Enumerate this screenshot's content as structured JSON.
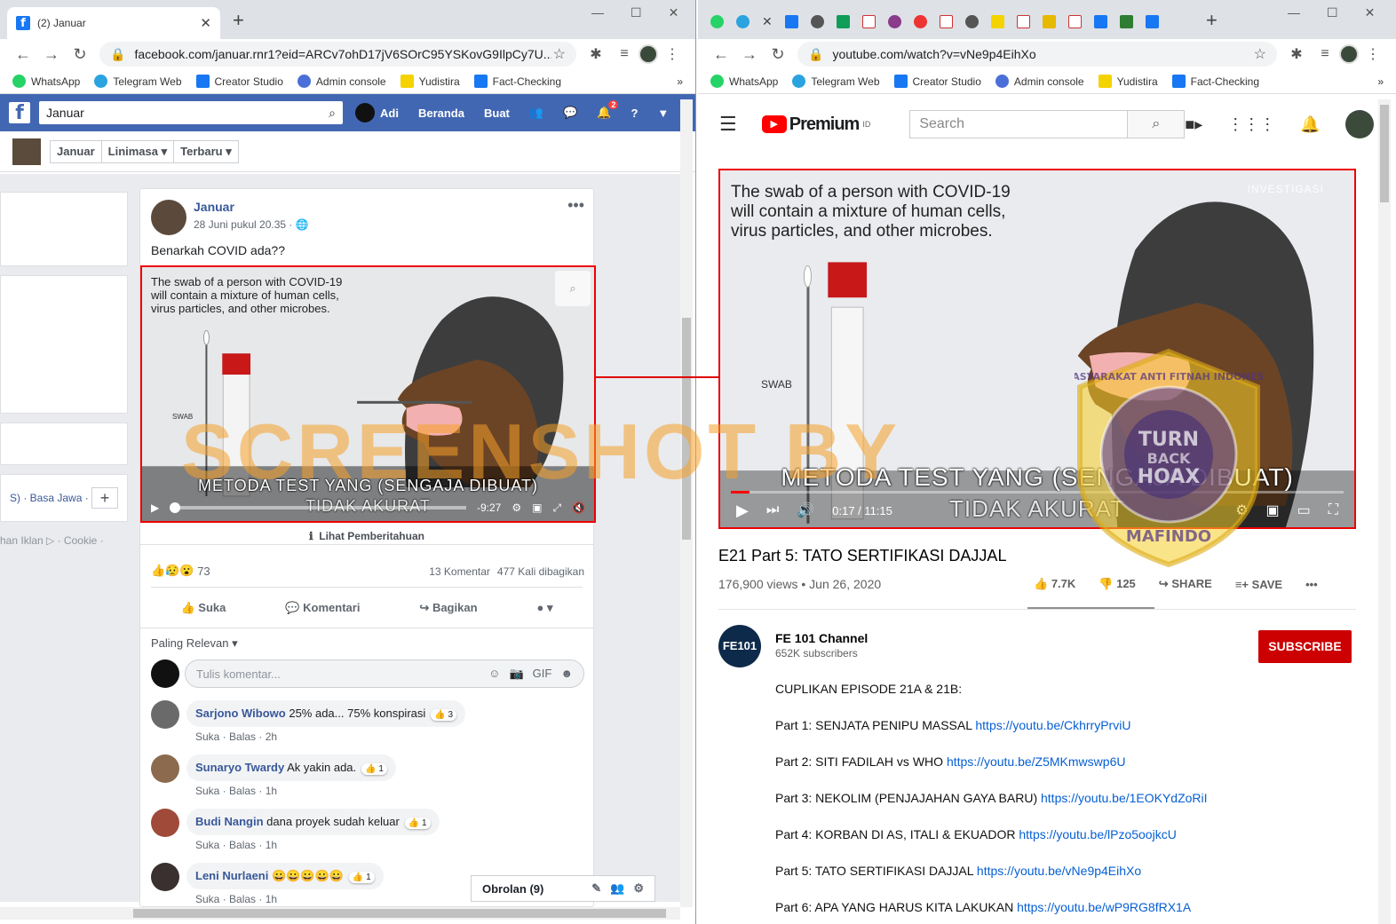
{
  "left": {
    "tab_title": "(2) Januar",
    "url": "facebook.com/januar.rnr1?eid=ARCv7ohD17jV6SOrC95YSKovG9IlpCy7U...",
    "bookmarks": [
      "WhatsApp",
      "Telegram Web",
      "Creator Studio",
      "Admin console",
      "Yudistira",
      "Fact-Checking"
    ],
    "fb": {
      "search_value": "Januar",
      "user": "Adi",
      "nav": [
        "Beranda",
        "Buat"
      ],
      "notif_count": "2",
      "crumbs": [
        "Januar",
        "Linimasa",
        "Terbaru"
      ]
    },
    "side": {
      "lang": "S) · Basa Jawa ·",
      "plus": "+",
      "footer": "han Iklan ▷ · Cookie ·"
    },
    "post": {
      "author": "Januar",
      "date": "28 Juni pukul 20.35 · ",
      "text": "Benarkah COVID ada??",
      "video_caption": "The swab of a person with COVID-19 will contain a mixture of human cells, virus particles, and other microbes.",
      "video_label": "SWAB",
      "subtitle1": "METODA TEST YANG (SENGAJA DIBUAT)",
      "subtitle2": "TIDAK AKURAT",
      "time_left": "-9:27",
      "notice": "Lihat Pemberitahuan",
      "reactions": "73",
      "comments_count": "13 Komentar",
      "shares": "477 Kali dibagikan",
      "actions": [
        "Suka",
        "Komentari",
        "Bagikan"
      ],
      "sort": "Paling Relevan",
      "comment_placeholder": "Tulis komentar...",
      "comments": [
        {
          "name": "Sarjono Wibowo",
          "text": "25% ada... 75% konspirasi",
          "meta": "Suka · Balas · 2h",
          "likes": "3"
        },
        {
          "name": "Sunaryo Twardy",
          "text": "Ak yakin ada.",
          "meta": "Suka · Balas · 1h",
          "likes": "1"
        },
        {
          "name": "Budi Nangin",
          "text": "dana proyek sudah keluar",
          "meta": "Suka · Balas · 1h",
          "likes": "1"
        },
        {
          "name": "Leni Nurlaeni",
          "text": "😀😀😀😀😀",
          "meta": "Suka · Balas · 1h",
          "likes": "1"
        }
      ],
      "chat": "Obrolan (9)"
    }
  },
  "right": {
    "url": "youtube.com/watch?v=vNe9p4EihXo",
    "bookmarks": [
      "WhatsApp",
      "Telegram Web",
      "Creator Studio",
      "Admin console",
      "Yudistira",
      "Fact-Checking"
    ],
    "yt": {
      "brand": "Premium",
      "region": "ID",
      "search_placeholder": "Search",
      "video_caption": "The swab of a person with COVID-19 will contain a mixture of human cells, virus particles, and other microbes.",
      "video_watermark": "INVESTIGASI",
      "video_label": "SWAB",
      "subtitle1": "METODA TEST YANG (SENGAJA DIBUAT)",
      "subtitle2": "TIDAK AKURAT",
      "time": "0:17 / 11:15",
      "title": "E21 Part 5: TATO SERTIFIKASI DAJJAL",
      "views": "176,900 views • Jun 26, 2020",
      "likes": "7.7K",
      "dislikes": "125",
      "share": "SHARE",
      "save": "SAVE",
      "channel": "FE 101 Channel",
      "channel_logo": "FE101",
      "subs": "652K subscribers",
      "subscribe": "SUBSCRIBE",
      "desc_head": "CUPLIKAN EPISODE 21A & 21B:",
      "parts": [
        {
          "label": "Part 1: SENJATA PENIPU MASSAL ",
          "link": "https://youtu.be/CkhrryPrviU"
        },
        {
          "label": "Part 2: SITI FADILAH vs WHO ",
          "link": "https://youtu.be/Z5MKmwswp6U"
        },
        {
          "label": "Part 3: NEKOLIM (PENJAJAHAN GAYA BARU) ",
          "link": "https://youtu.be/1EOKYdZoRiI"
        },
        {
          "label": "Part 4: KORBAN DI AS, ITALI & EKUADOR ",
          "link": "https://youtu.be/lPzo5oojkcU"
        },
        {
          "label": "Part 5: TATO SERTIFIKASI DAJJAL ",
          "link": "https://youtu.be/vNe9p4EihXo"
        },
        {
          "label": "Part 6: APA YANG HARUS KITA LAKUKAN ",
          "link": "https://youtu.be/wP9RG8fRX1A"
        }
      ]
    }
  },
  "overlay": {
    "watermark": "SCREENSHOT BY",
    "seal_top": "MASYARAKAT ANTI FITNAH INDONESIA",
    "seal_mid1": "TURN",
    "seal_mid2": "BACK",
    "seal_mid3": "HOAX",
    "seal_bottom": "MAFINDO"
  },
  "colors": {
    "fb_blue": "#4267b2",
    "yt_red": "#ff0000",
    "highlight": "#e00000",
    "link": "#065fd4"
  }
}
